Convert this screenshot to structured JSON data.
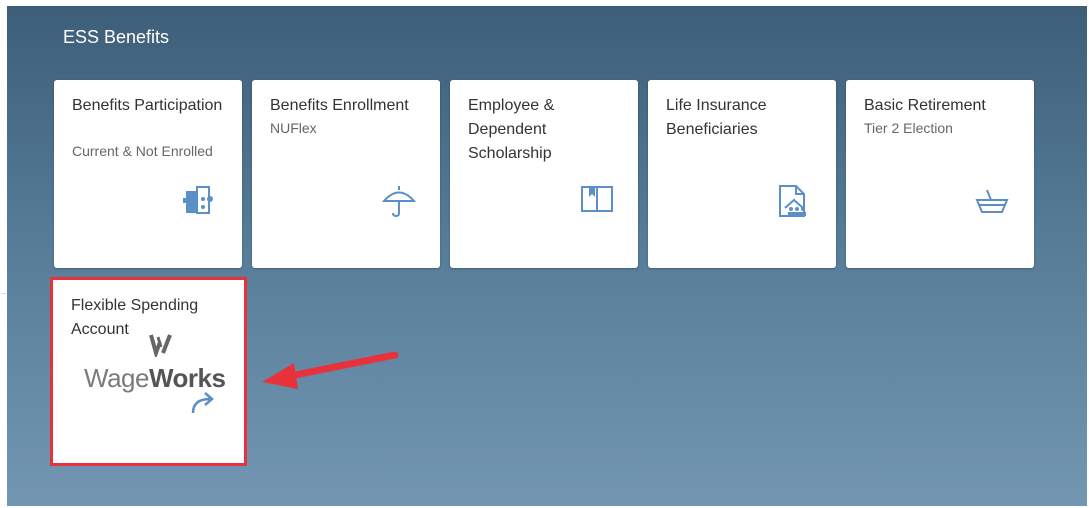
{
  "group": {
    "title": "ESS Benefits"
  },
  "tiles": [
    {
      "title": "Benefits Participation",
      "subtitle": "Current & Not Enrolled",
      "icon": "puzzle-icon"
    },
    {
      "title": "Benefits Enrollment",
      "subtitle": "NUFlex",
      "icon": "umbrella-icon"
    },
    {
      "title": "Employee & Dependent Scholarship",
      "subtitle": "",
      "icon": "open-book-icon"
    },
    {
      "title": "Life Insurance Beneficiaries",
      "subtitle": "",
      "icon": "family-document-icon"
    },
    {
      "title": "Basic Retirement",
      "subtitle": "Tier 2 Election",
      "icon": "basket-icon"
    }
  ],
  "fsa_tile": {
    "title": "Flexible Spending Account",
    "logo_light": "Wage",
    "logo_bold": "Works",
    "icon": "forward-arrow-icon"
  },
  "colors": {
    "background_top": "#3d5e78",
    "background_bottom": "#7397b3",
    "icon_blue": "#5b8fc7",
    "highlight_red": "#e8323b"
  }
}
